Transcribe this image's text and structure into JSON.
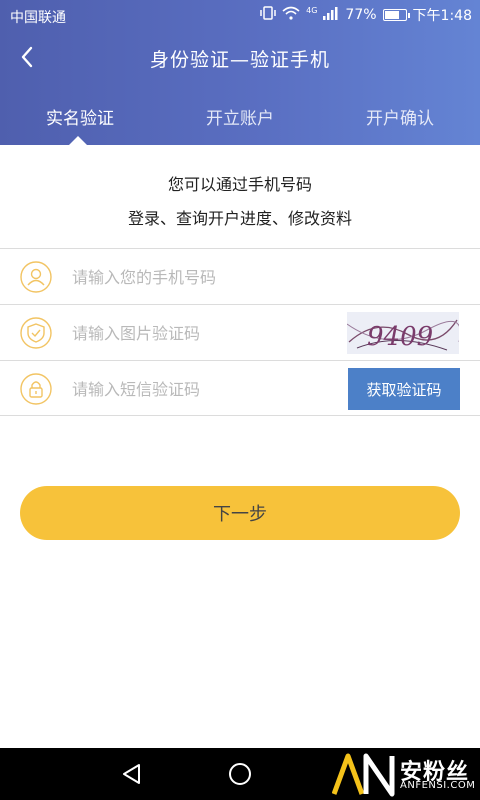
{
  "status_bar": {
    "carrier": "中国联通",
    "signal_label": "4G",
    "battery": "77%",
    "battery_level": 0.77,
    "time": "下午1:48"
  },
  "header": {
    "title": "身份验证—验证手机"
  },
  "tabs": [
    {
      "label": "实名验证",
      "active": true
    },
    {
      "label": "开立账户",
      "active": false
    },
    {
      "label": "开户确认",
      "active": false
    }
  ],
  "intro": {
    "line1": "您可以通过手机号码",
    "line2": "登录、查询开户进度、修改资料"
  },
  "form": {
    "phone": {
      "placeholder": "请输入您的手机号码",
      "value": ""
    },
    "captcha": {
      "placeholder": "请输入图片验证码",
      "value": "",
      "image_text": "9409"
    },
    "sms": {
      "placeholder": "请输入短信验证码",
      "value": "",
      "button_label": "获取验证码"
    }
  },
  "next_button": "下一步",
  "watermark": {
    "logo": "AN",
    "text": "安粉丝",
    "sub": "ANFENSI.COM"
  },
  "colors": {
    "header_start": "#4f5fae",
    "header_end": "#6484d4",
    "accent_yellow": "#f7c23a",
    "button_blue": "#4c80c8",
    "icon_yellow": "#f2c463"
  },
  "icons": {
    "back": "chevron-left-icon",
    "phone_row": "user-icon",
    "captcha_row": "shield-icon",
    "sms_row": "lock-icon",
    "nav_back": "triangle-back-icon",
    "nav_home": "circle-home-icon"
  }
}
